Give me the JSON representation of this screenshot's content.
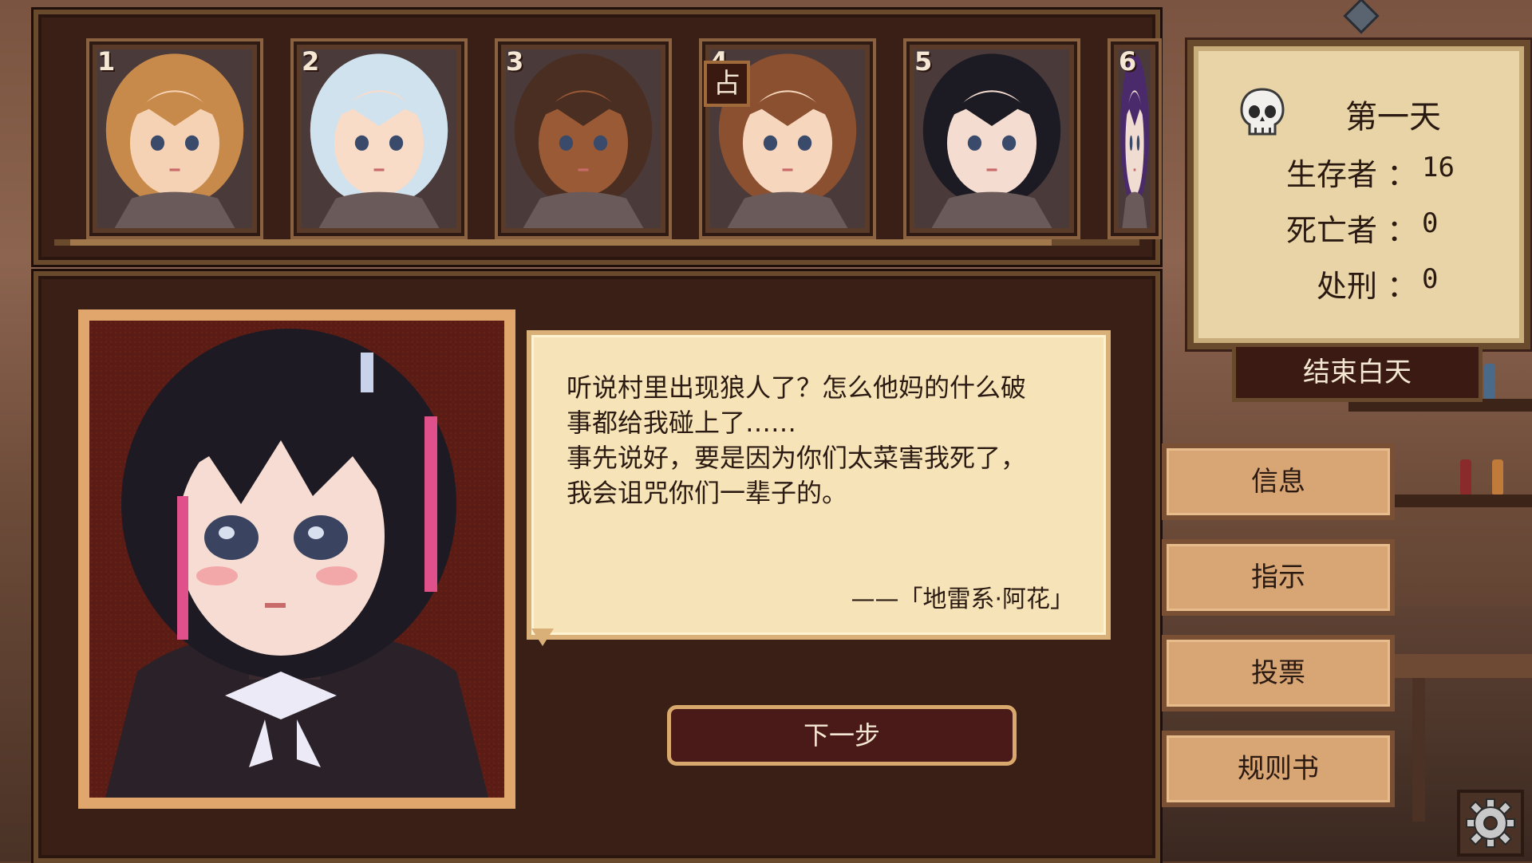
{
  "roster": [
    {
      "number": "1",
      "hair": "#c88a4a",
      "skin": "#f6d2b4"
    },
    {
      "number": "2",
      "hair": "#cfe2ee",
      "skin": "#f8dcc8"
    },
    {
      "number": "3",
      "hair": "#4a2e22",
      "skin": "#9a5a36"
    },
    {
      "number": "4",
      "hair": "#8a5030",
      "skin": "#f6d6bc",
      "role_badge": "占"
    },
    {
      "number": "5",
      "hair": "#1c1a22",
      "skin": "#f4dcd0"
    },
    {
      "number": "6",
      "hair": "#4a2a6a",
      "skin": "#f0dcd0"
    }
  ],
  "dialogue": {
    "text": "听说村里出现狼人了？怎么他妈的什么破\n事都给我碰上了……\n事先说好，要是因为你们太菜害我死了，\n我会诅咒你们一辈子的。",
    "attribution": "——「地雷系·阿花」"
  },
  "next_button": "下一步",
  "status": {
    "day": "第一天",
    "survivors_label": "生存者 ：",
    "survivors_value": "16",
    "dead_label": "死亡者 ：",
    "dead_value": "0",
    "executed_label": "处刑 ：",
    "executed_value": "0"
  },
  "end_day_button": "结束白天",
  "side_buttons": {
    "info": "信息",
    "instructions": "指示",
    "vote": "投票",
    "rulebook": "规则书"
  },
  "colors": {
    "panel_bg": "#3a1f16",
    "bubble_bg": "#f6e4b8",
    "button_bg": "#d8a574",
    "accent_pink": "#e0508a"
  },
  "icons": [
    "skull-icon",
    "gear-icon"
  ]
}
